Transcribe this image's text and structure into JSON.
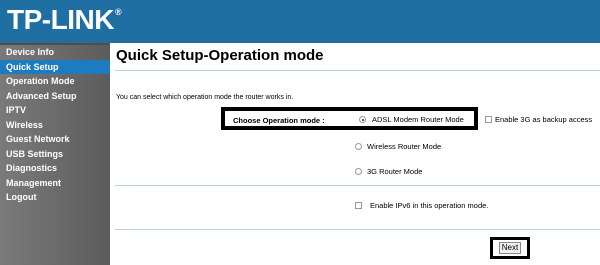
{
  "brand": {
    "logo_text": "TP-LINK",
    "registered_mark": "®"
  },
  "sidebar": {
    "items": [
      {
        "label": "Device Info"
      },
      {
        "label": "Quick Setup",
        "active": true
      },
      {
        "label": "Operation Mode"
      },
      {
        "label": "Advanced Setup"
      },
      {
        "label": "IPTV"
      },
      {
        "label": "Wireless"
      },
      {
        "label": "Guest Network"
      },
      {
        "label": "USB Settings"
      },
      {
        "label": "Diagnostics"
      },
      {
        "label": "Management"
      },
      {
        "label": "Logout"
      }
    ]
  },
  "main": {
    "title": "Quick Setup-Operation mode",
    "description": "You can select which operation mode the router works in.",
    "choose_label": "Choose Operation mode :",
    "modes": [
      {
        "label": "ADSL Modem Router Mode",
        "selected": true
      },
      {
        "label": "Wireless Router Mode",
        "selected": false
      },
      {
        "label": "3G Router Mode",
        "selected": false
      }
    ],
    "backup_3g_label": "Enable 3G as backup access",
    "backup_3g_checked": false,
    "ipv6_label": "Enable IPv6 in this operation mode.",
    "ipv6_checked": false,
    "next_label": "Next"
  },
  "colors": {
    "header": "#1f6fa3",
    "sidebar": "#6e6e6e",
    "sidebar_active": "#1e7bc0",
    "divider": "#b7cfe0"
  }
}
